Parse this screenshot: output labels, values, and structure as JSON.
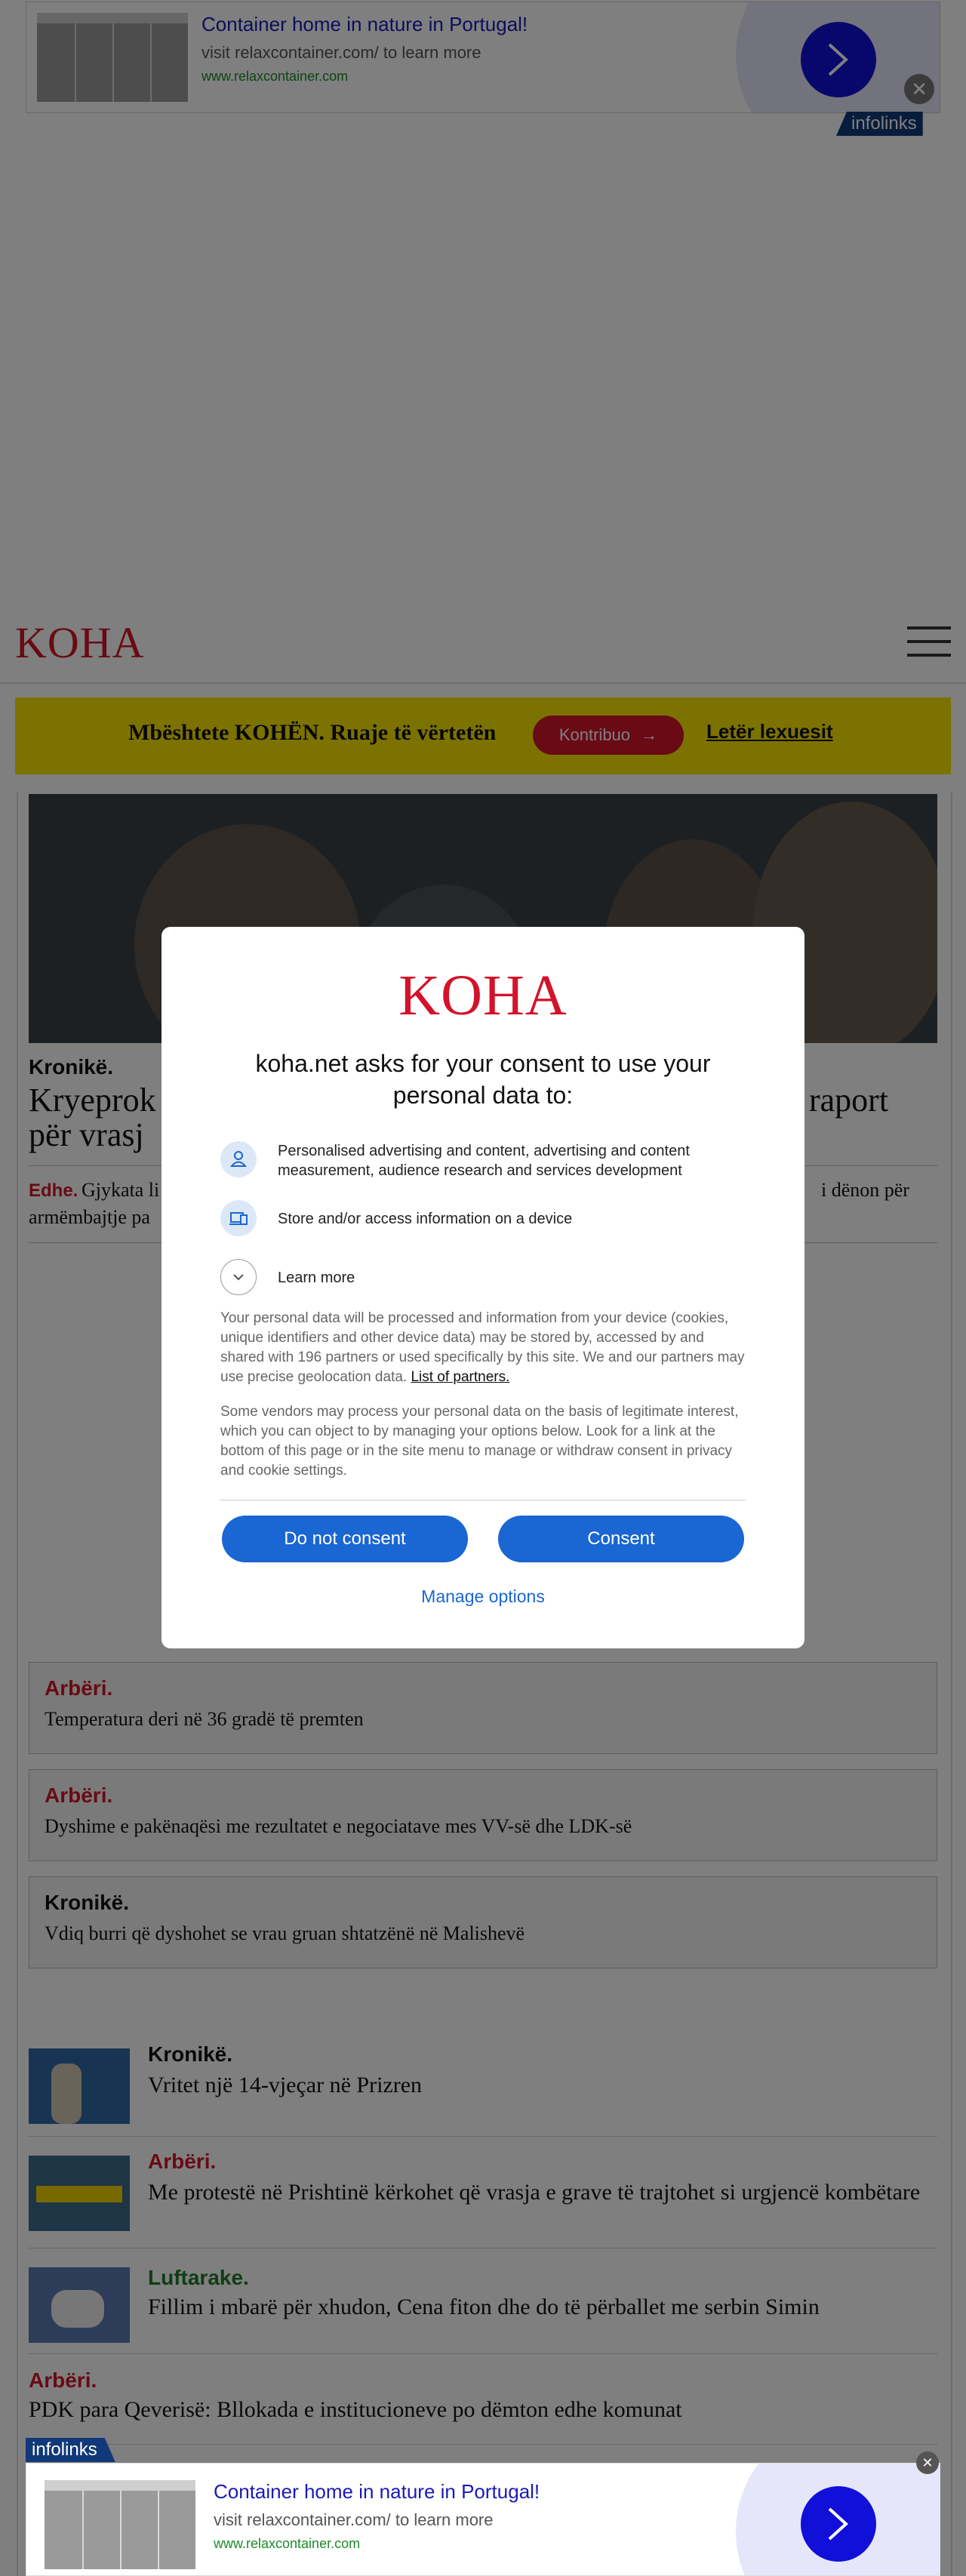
{
  "top_ad": {
    "title": "Container home in nature in Portugal!",
    "description": "visit relaxcontainer.com/ to learn more",
    "url": "www.relaxcontainer.com",
    "badge": "infolinks",
    "close": "✕"
  },
  "header": {
    "logo": "KOHA"
  },
  "support_bar": {
    "text": "Mbështete KOHËN. Ruaje të vërtetën",
    "button": "Kontribuo",
    "link": "Letër lexuesit"
  },
  "lead_article": {
    "category": "Kronikë.",
    "headline_start": "Kryeprok",
    "headline_end": "raport",
    "headline_line2": "për vrasj",
    "sub_category": "Edhe.",
    "sub_text_start": "Gjykata li",
    "sub_text_end": "i dënon për",
    "sub_text_line2": "armëmbajtje pa"
  },
  "box_articles": [
    {
      "category": "Arbëri.",
      "headline": "Temperatura deri në 36 gradë të premten"
    },
    {
      "category": "Arbëri.",
      "headline": "Dyshime e pakënaqësi me rezultatet e negociatave mes VV-së dhe LDK-së"
    },
    {
      "category": "Kronikë.",
      "headline": "Vdiq burri që dyshohet se vrau gruan shtatzënë në Malishevë"
    }
  ],
  "list_articles": [
    {
      "category": "Kronikë.",
      "headline": "Vritet një 14-vjeçar në Prizren"
    },
    {
      "category": "Arbëri.",
      "headline": "Me protestë në Prishtinë kërkohet që vrasja e grave të trajtohet si urgjencë kombëtare"
    },
    {
      "category": "Luftarake.",
      "headline": "Fillim i mbarë për xhudon, Cena fiton dhe do të përballet me serbin Simin"
    },
    {
      "category": "Arbëri.",
      "headline": "PDK para Qeverisë: Bllokada e institucioneve po dëmton edhe komunat"
    }
  ],
  "consent": {
    "logo": "KOHA",
    "title": "koha.net asks for your consent to use your personal data to:",
    "purposes": [
      {
        "icon": "person-icon",
        "text": "Personalised advertising and content, advertising and content measurement, audience research and services development"
      },
      {
        "icon": "device-icon",
        "text": "Store and/or access information on a device"
      }
    ],
    "learn_more": "Learn more",
    "paragraph1": "Your personal data will be processed and information from your device (cookies, unique identifiers and other device data) may be stored by, accessed by and shared with 196 partners or used specifically by this site. We and our partners may use precise geolocation data.",
    "partners_link": "List of partners.",
    "paragraph2": "Some vendors may process your personal data on the basis of legitimate interest, which you can object to by managing your options below. Look for a link at the bottom of this page or in the site menu to manage or withdraw consent in privacy and cookie settings.",
    "do_not_consent": "Do not consent",
    "consent": "Consent",
    "manage_options": "Manage options"
  },
  "bottom_ad": {
    "title": "Container home in nature in Portugal!",
    "description": "visit relaxcontainer.com/ to learn more",
    "url": "www.relaxcontainer.com",
    "badge": "infolinks",
    "close": "✕"
  },
  "colors": {
    "brand_red": "#d2142b",
    "support_yellow": "#f8e400",
    "consent_blue": "#1a66d2",
    "infolinks_navy": "#113878"
  }
}
